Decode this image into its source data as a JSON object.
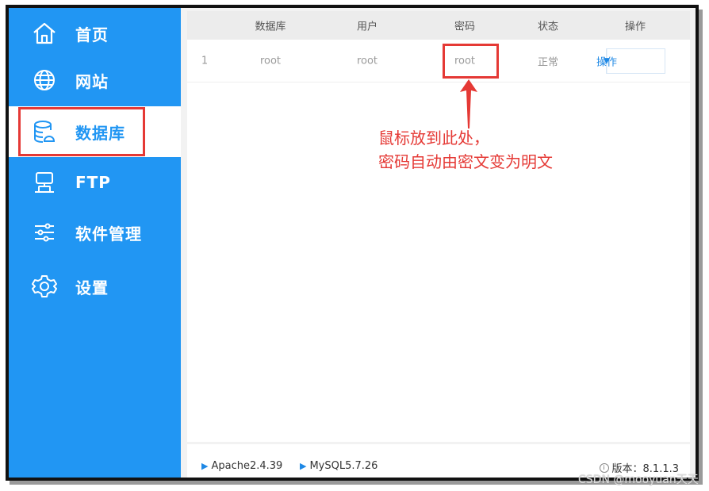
{
  "sidebar": {
    "items": [
      {
        "label": "首页",
        "icon": "home-icon"
      },
      {
        "label": "网站",
        "icon": "globe-icon"
      },
      {
        "label": "数据库",
        "icon": "database-icon",
        "active": true
      },
      {
        "label": "FTP",
        "icon": "server-icon"
      },
      {
        "label": "软件管理",
        "icon": "sliders-icon"
      },
      {
        "label": "设置",
        "icon": "gear-icon"
      }
    ]
  },
  "table": {
    "columns": [
      "数据库",
      "用户",
      "密码",
      "状态",
      "操作"
    ],
    "rows": [
      {
        "id": "1",
        "database": "root",
        "user": "root",
        "password": "root",
        "status": "正常",
        "action": "操作"
      }
    ]
  },
  "annotation": {
    "line1": "鼠标放到此处，",
    "line2": "密码自动由密文变为明文"
  },
  "footer": {
    "apache": "Apache2.4.39",
    "mysql": "MySQL5.7.26",
    "version": "版本：8.1.1.3"
  },
  "watermark": "CSDN @mooyuan天天",
  "colors": {
    "sidebar": "#2196f3",
    "highlight": "#e53935",
    "accent": "#1e88e5"
  }
}
